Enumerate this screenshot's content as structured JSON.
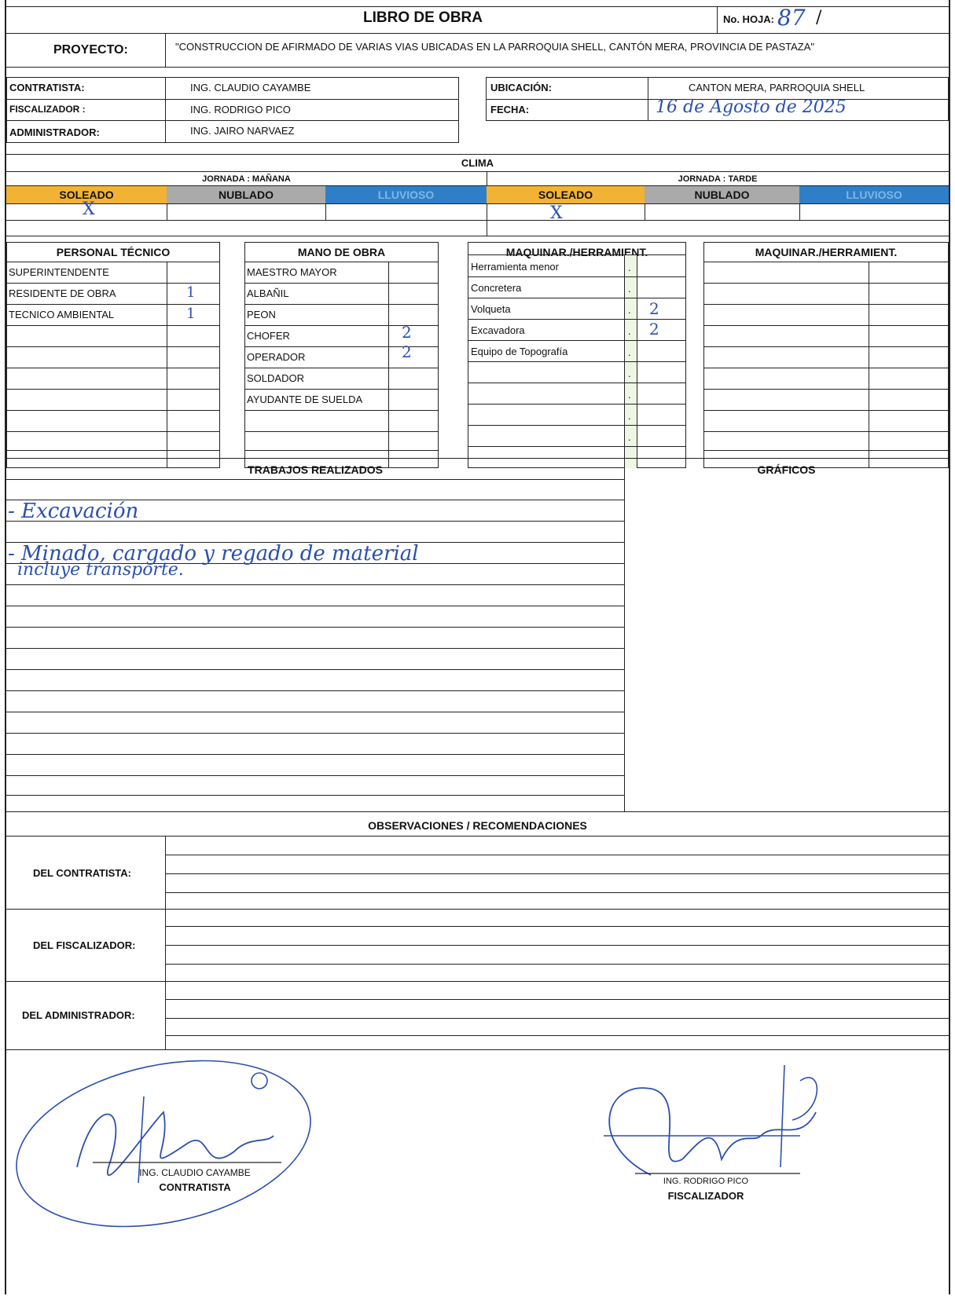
{
  "header": {
    "title": "LIBRO DE OBRA",
    "hoja_label": "No. HOJA:",
    "hoja_value": "87",
    "hoja_sep": "/"
  },
  "project": {
    "label": "PROYECTO:",
    "value": "\"CONSTRUCCION DE AFIRMADO DE VARIAS VIAS UBICADAS EN LA PARROQUIA SHELL, CANTÓN MERA, PROVINCIA DE PASTAZA\""
  },
  "info": {
    "contratista_label": "CONTRATISTA:",
    "contratista_value": "ING. CLAUDIO CAYAMBE",
    "fiscalizador_label": "FISCALIZADOR :",
    "fiscalizador_value": "ING. RODRIGO PICO",
    "administrador_label": "ADMINISTRADOR:",
    "administrador_value": "ING. JAIRO NARVAEZ",
    "ubicacion_label": "UBICACIÓN:",
    "ubicacion_value": "CANTON MERA, PARROQUIA SHELL",
    "fecha_label": "FECHA:",
    "fecha_value": "16 de Agosto de 2025"
  },
  "clima": {
    "title": "CLIMA",
    "morning_label": "JORNADA : MAÑANA",
    "afternoon_label": "JORNADA : TARDE",
    "soleado": "SOLEADO",
    "nublado": "NUBLADO",
    "lluvioso": "LLUVIOSO",
    "mark": "X",
    "colors": {
      "soleado": "#f2b233",
      "nublado": "#a9aaa9",
      "lluvioso": "#2f7fc8"
    }
  },
  "personal_tecnico": {
    "title": "PERSONAL TÉCNICO",
    "rows": [
      {
        "name": "SUPERINTENDENTE",
        "qty": ""
      },
      {
        "name": "RESIDENTE DE OBRA",
        "qty": "1"
      },
      {
        "name": "TECNICO AMBIENTAL",
        "qty": "1"
      }
    ]
  },
  "mano_de_obra": {
    "title": "MANO DE OBRA",
    "rows": [
      {
        "name": "MAESTRO MAYOR",
        "qty": ""
      },
      {
        "name": "ALBAÑIL",
        "qty": ""
      },
      {
        "name": "PEON",
        "qty": ""
      },
      {
        "name": "CHOFER",
        "qty": "2"
      },
      {
        "name": "OPERADOR",
        "qty": "2"
      },
      {
        "name": "SOLDADOR",
        "qty": ""
      },
      {
        "name": "AYUDANTE DE SUELDA",
        "qty": ""
      }
    ]
  },
  "maquinaria_1": {
    "title": "MAQUINAR./HERRAMIENT.",
    "rows": [
      {
        "name": "Herramienta menor",
        "qty": ""
      },
      {
        "name": "Concretera",
        "qty": ""
      },
      {
        "name": "Volqueta",
        "qty": "2"
      },
      {
        "name": "Excavadora",
        "qty": "2"
      },
      {
        "name": "Equipo de Topografía",
        "qty": ""
      }
    ],
    "dot": "."
  },
  "maquinaria_2": {
    "title": "MAQUINAR./HERRAMIENT."
  },
  "trabajos": {
    "title": "TRABAJOS REALIZADOS",
    "lines": [
      "- Excavación",
      "- Minado, cargado y regado de material",
      "incluye transporte."
    ]
  },
  "graficos": {
    "title": "GRÁFICOS"
  },
  "observaciones": {
    "title": "OBSERVACIONES / RECOMENDACIONES",
    "contratista": "DEL CONTRATISTA:",
    "fiscalizador": "DEL FISCALIZADOR:",
    "administrador": "DEL ADMINISTRADOR:"
  },
  "firmas": {
    "contratista_name": "ING. CLAUDIO CAYAMBE",
    "contratista_role": "CONTRATISTA",
    "fiscalizador_name": "ING. RODRIGO PICO",
    "fiscalizador_role": "FISCALIZADOR"
  }
}
